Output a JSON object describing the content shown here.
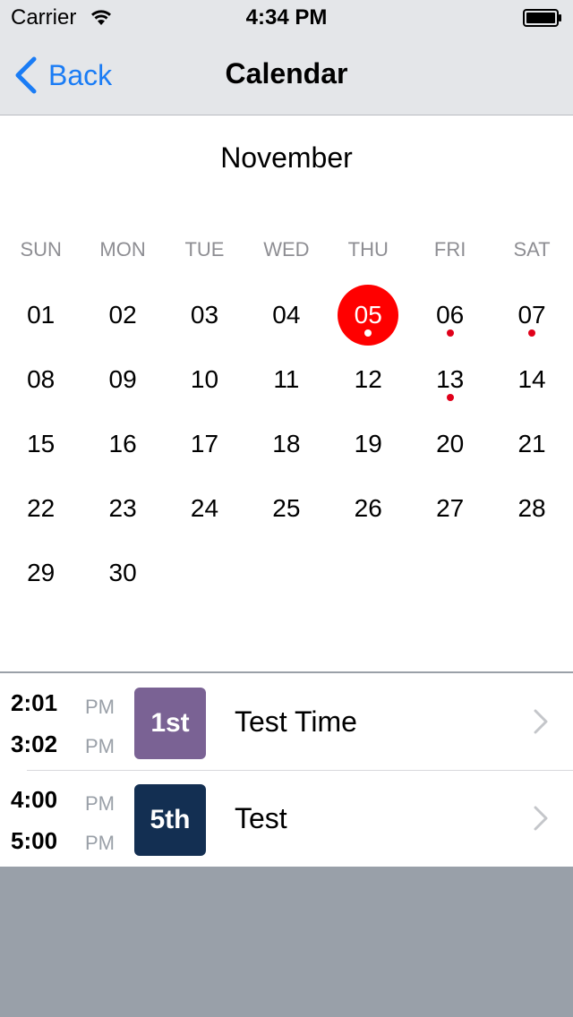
{
  "status": {
    "carrier": "Carrier",
    "time": "4:34 PM"
  },
  "nav": {
    "back_label": "Back",
    "title": "Calendar"
  },
  "calendar": {
    "month": "November",
    "weekdays": [
      "SUN",
      "MON",
      "TUE",
      "WED",
      "THU",
      "FRI",
      "SAT"
    ],
    "weeks": [
      [
        {
          "d": "01"
        },
        {
          "d": "02"
        },
        {
          "d": "03"
        },
        {
          "d": "04"
        },
        {
          "d": "05",
          "selected": true,
          "dot": true
        },
        {
          "d": "06",
          "dot": true
        },
        {
          "d": "07",
          "dot": true
        }
      ],
      [
        {
          "d": "08"
        },
        {
          "d": "09"
        },
        {
          "d": "10"
        },
        {
          "d": "11"
        },
        {
          "d": "12"
        },
        {
          "d": "13",
          "dot": true
        },
        {
          "d": "14"
        }
      ],
      [
        {
          "d": "15"
        },
        {
          "d": "16"
        },
        {
          "d": "17"
        },
        {
          "d": "18"
        },
        {
          "d": "19"
        },
        {
          "d": "20"
        },
        {
          "d": "21"
        }
      ],
      [
        {
          "d": "22"
        },
        {
          "d": "23"
        },
        {
          "d": "24"
        },
        {
          "d": "25"
        },
        {
          "d": "26"
        },
        {
          "d": "27"
        },
        {
          "d": "28"
        }
      ],
      [
        {
          "d": "29"
        },
        {
          "d": "30"
        }
      ]
    ]
  },
  "events": [
    {
      "start": "2:01",
      "start_ampm": "PM",
      "end": "3:02",
      "end_ampm": "PM",
      "badge": "1st",
      "badge_color": "#7a6294",
      "title": "Test Time"
    },
    {
      "start": "4:00",
      "start_ampm": "PM",
      "end": "5:00",
      "end_ampm": "PM",
      "badge": "5th",
      "badge_color": "#132f52",
      "title": "Test"
    }
  ],
  "colors": {
    "accent": "#1a7cf5",
    "selected": "#ff0000",
    "dot": "#e0001a"
  }
}
